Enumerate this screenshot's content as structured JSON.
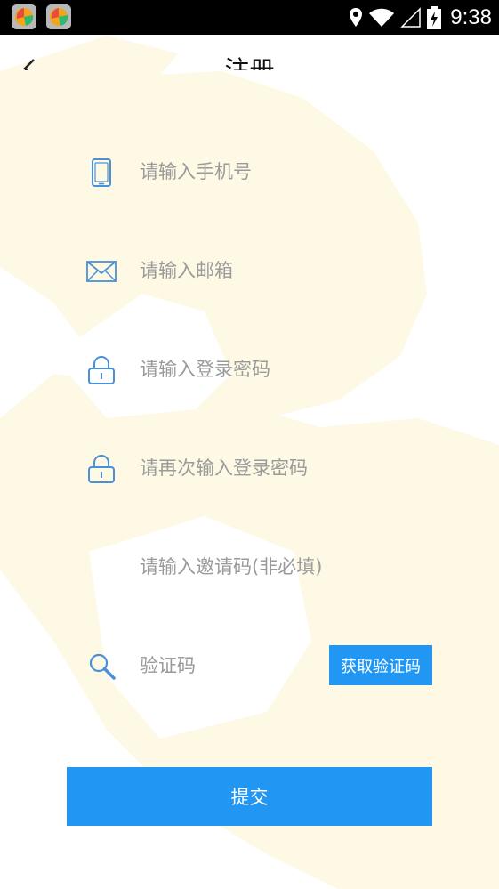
{
  "status_bar": {
    "time": "9:38"
  },
  "header": {
    "title": "注册"
  },
  "form": {
    "phone_placeholder": "请输入手机号",
    "email_placeholder": "请输入邮箱",
    "password_placeholder": "请输入登录密码",
    "confirm_password_placeholder": "请再次输入登录密码",
    "invite_placeholder": "请输入邀请码(非必填)",
    "code_placeholder": "验证码",
    "get_code_label": "获取验证码",
    "submit_label": "提交"
  },
  "colors": {
    "accent": "#2196f3",
    "icon": "#4a90d9",
    "placeholder": "#9a9a9a",
    "watermark": "#fdf9e4"
  }
}
